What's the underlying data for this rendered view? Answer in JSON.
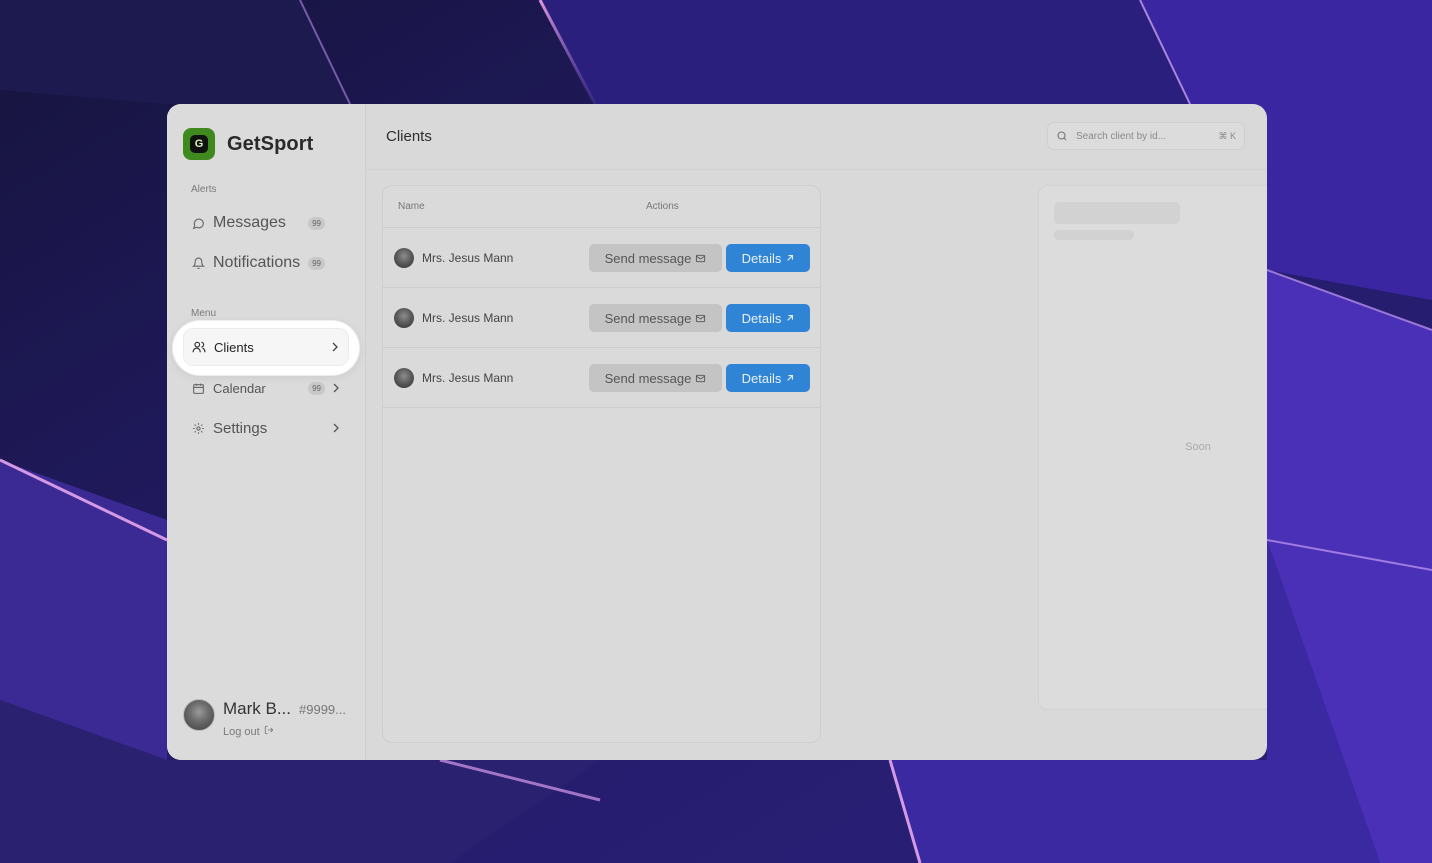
{
  "brand": {
    "name": "GetSport",
    "logo_letter": "G"
  },
  "sidebar": {
    "alerts_label": "Alerts",
    "alerts": [
      {
        "label": "Messages",
        "badge": "99",
        "icon": "message-circle-icon"
      },
      {
        "label": "Notifications",
        "badge": "99",
        "icon": "bell-icon"
      }
    ],
    "menu_label": "Menu",
    "menu": [
      {
        "label": "Clients",
        "icon": "users-icon",
        "active": true
      },
      {
        "label": "Calendar",
        "badge": "99",
        "icon": "calendar-icon"
      },
      {
        "label": "Settings",
        "icon": "gear-icon"
      }
    ]
  },
  "user": {
    "name": "Mark B...",
    "id": "#9999...",
    "logout_label": "Log out"
  },
  "header": {
    "title": "Clients",
    "search_placeholder": "Search client by id...",
    "shortcut": "⌘ K"
  },
  "table": {
    "columns": {
      "name": "Name",
      "actions": "Actions"
    },
    "rows": [
      {
        "name": "Mrs. Jesus Mann",
        "send_label": "Send message",
        "details_label": "Details"
      },
      {
        "name": "Mrs. Jesus Mann",
        "send_label": "Send message",
        "details_label": "Details"
      },
      {
        "name": "Mrs. Jesus Mann",
        "send_label": "Send message",
        "details_label": "Details"
      }
    ]
  },
  "preview": {
    "status": "Soon"
  },
  "colors": {
    "brand": "#3f8a1f",
    "primary_button": "#2f84d6",
    "wallpaper": "#1a1748"
  }
}
